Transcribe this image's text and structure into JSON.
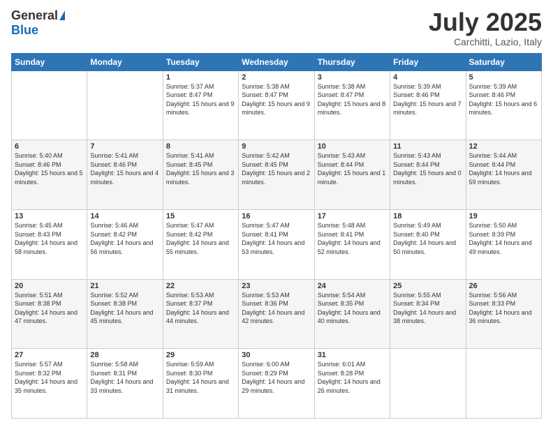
{
  "logo": {
    "general": "General",
    "blue": "Blue"
  },
  "header": {
    "month": "July 2025",
    "location": "Carchitti, Lazio, Italy"
  },
  "weekdays": [
    "Sunday",
    "Monday",
    "Tuesday",
    "Wednesday",
    "Thursday",
    "Friday",
    "Saturday"
  ],
  "weeks": [
    [
      {
        "day": "",
        "info": ""
      },
      {
        "day": "",
        "info": ""
      },
      {
        "day": "1",
        "info": "Sunrise: 5:37 AM\nSunset: 8:47 PM\nDaylight: 15 hours and 9 minutes."
      },
      {
        "day": "2",
        "info": "Sunrise: 5:38 AM\nSunset: 8:47 PM\nDaylight: 15 hours and 9 minutes."
      },
      {
        "day": "3",
        "info": "Sunrise: 5:38 AM\nSunset: 8:47 PM\nDaylight: 15 hours and 8 minutes."
      },
      {
        "day": "4",
        "info": "Sunrise: 5:39 AM\nSunset: 8:46 PM\nDaylight: 15 hours and 7 minutes."
      },
      {
        "day": "5",
        "info": "Sunrise: 5:39 AM\nSunset: 8:46 PM\nDaylight: 15 hours and 6 minutes."
      }
    ],
    [
      {
        "day": "6",
        "info": "Sunrise: 5:40 AM\nSunset: 8:46 PM\nDaylight: 15 hours and 5 minutes."
      },
      {
        "day": "7",
        "info": "Sunrise: 5:41 AM\nSunset: 8:46 PM\nDaylight: 15 hours and 4 minutes."
      },
      {
        "day": "8",
        "info": "Sunrise: 5:41 AM\nSunset: 8:45 PM\nDaylight: 15 hours and 3 minutes."
      },
      {
        "day": "9",
        "info": "Sunrise: 5:42 AM\nSunset: 8:45 PM\nDaylight: 15 hours and 2 minutes."
      },
      {
        "day": "10",
        "info": "Sunrise: 5:43 AM\nSunset: 8:44 PM\nDaylight: 15 hours and 1 minute."
      },
      {
        "day": "11",
        "info": "Sunrise: 5:43 AM\nSunset: 8:44 PM\nDaylight: 15 hours and 0 minutes."
      },
      {
        "day": "12",
        "info": "Sunrise: 5:44 AM\nSunset: 8:44 PM\nDaylight: 14 hours and 59 minutes."
      }
    ],
    [
      {
        "day": "13",
        "info": "Sunrise: 5:45 AM\nSunset: 8:43 PM\nDaylight: 14 hours and 58 minutes."
      },
      {
        "day": "14",
        "info": "Sunrise: 5:46 AM\nSunset: 8:42 PM\nDaylight: 14 hours and 56 minutes."
      },
      {
        "day": "15",
        "info": "Sunrise: 5:47 AM\nSunset: 8:42 PM\nDaylight: 14 hours and 55 minutes."
      },
      {
        "day": "16",
        "info": "Sunrise: 5:47 AM\nSunset: 8:41 PM\nDaylight: 14 hours and 53 minutes."
      },
      {
        "day": "17",
        "info": "Sunrise: 5:48 AM\nSunset: 8:41 PM\nDaylight: 14 hours and 52 minutes."
      },
      {
        "day": "18",
        "info": "Sunrise: 5:49 AM\nSunset: 8:40 PM\nDaylight: 14 hours and 50 minutes."
      },
      {
        "day": "19",
        "info": "Sunrise: 5:50 AM\nSunset: 8:39 PM\nDaylight: 14 hours and 49 minutes."
      }
    ],
    [
      {
        "day": "20",
        "info": "Sunrise: 5:51 AM\nSunset: 8:38 PM\nDaylight: 14 hours and 47 minutes."
      },
      {
        "day": "21",
        "info": "Sunrise: 5:52 AM\nSunset: 8:38 PM\nDaylight: 14 hours and 45 minutes."
      },
      {
        "day": "22",
        "info": "Sunrise: 5:53 AM\nSunset: 8:37 PM\nDaylight: 14 hours and 44 minutes."
      },
      {
        "day": "23",
        "info": "Sunrise: 5:53 AM\nSunset: 8:36 PM\nDaylight: 14 hours and 42 minutes."
      },
      {
        "day": "24",
        "info": "Sunrise: 5:54 AM\nSunset: 8:35 PM\nDaylight: 14 hours and 40 minutes."
      },
      {
        "day": "25",
        "info": "Sunrise: 5:55 AM\nSunset: 8:34 PM\nDaylight: 14 hours and 38 minutes."
      },
      {
        "day": "26",
        "info": "Sunrise: 5:56 AM\nSunset: 8:33 PM\nDaylight: 14 hours and 36 minutes."
      }
    ],
    [
      {
        "day": "27",
        "info": "Sunrise: 5:57 AM\nSunset: 8:32 PM\nDaylight: 14 hours and 35 minutes."
      },
      {
        "day": "28",
        "info": "Sunrise: 5:58 AM\nSunset: 8:31 PM\nDaylight: 14 hours and 33 minutes."
      },
      {
        "day": "29",
        "info": "Sunrise: 5:59 AM\nSunset: 8:30 PM\nDaylight: 14 hours and 31 minutes."
      },
      {
        "day": "30",
        "info": "Sunrise: 6:00 AM\nSunset: 8:29 PM\nDaylight: 14 hours and 29 minutes."
      },
      {
        "day": "31",
        "info": "Sunrise: 6:01 AM\nSunset: 8:28 PM\nDaylight: 14 hours and 26 minutes."
      },
      {
        "day": "",
        "info": ""
      },
      {
        "day": "",
        "info": ""
      }
    ]
  ]
}
